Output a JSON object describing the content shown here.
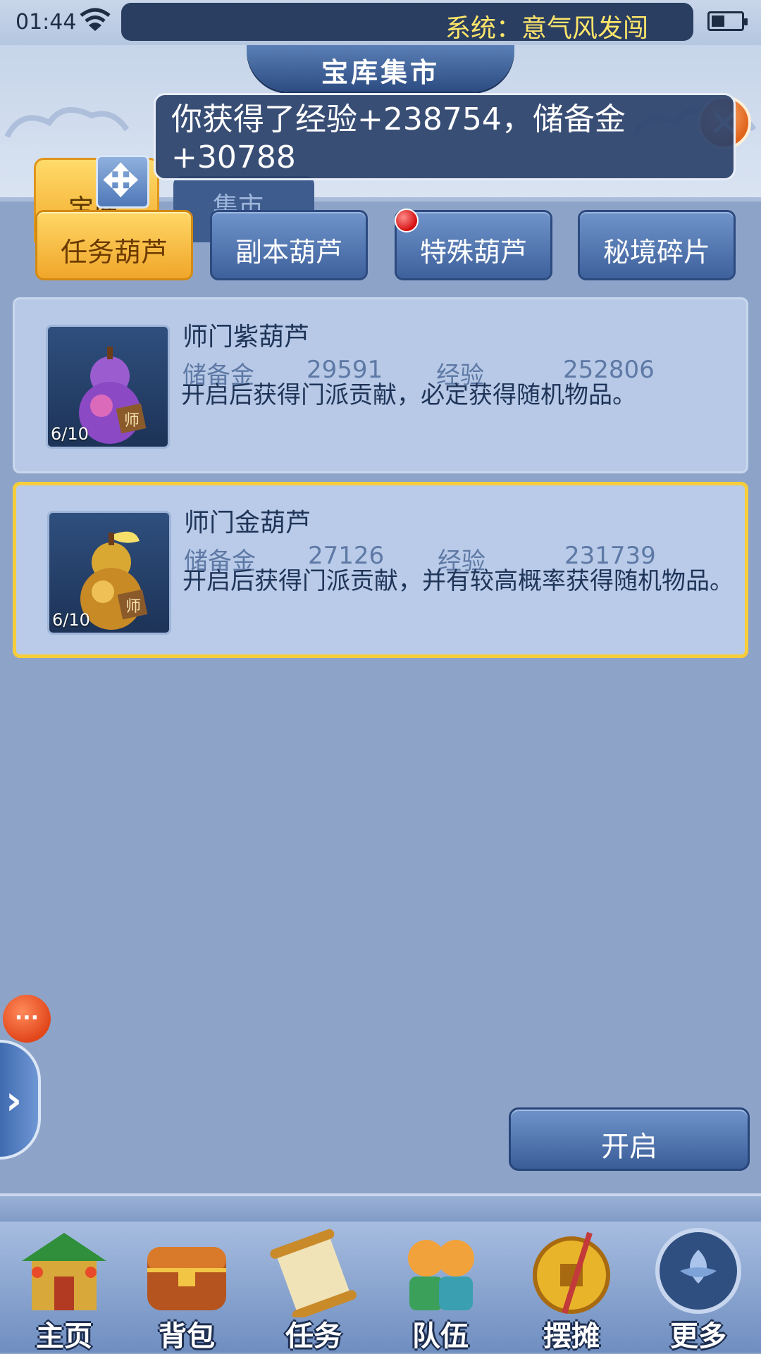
{
  "status_bar": {
    "time": "01:44",
    "marquee": "系统：意气风发闯",
    "icons": [
      "wifi-icon",
      "battery-icon"
    ]
  },
  "header": {
    "title": "宝库集市",
    "close_icon": "close-icon",
    "tabs": [
      {
        "label": "宝库",
        "active": true
      },
      {
        "label": "集市",
        "active": false
      }
    ]
  },
  "toast": {
    "message": "你获得了经验+238754，储备金+30788"
  },
  "categories": [
    {
      "label": "任务葫芦",
      "active": true
    },
    {
      "label": "副本葫芦",
      "active": false
    },
    {
      "label": "特殊葫芦",
      "active": false,
      "badge": "red-dot"
    },
    {
      "label": "秘境碎片",
      "active": false
    }
  ],
  "items": [
    {
      "name": "师门紫葫芦",
      "count": "6/10",
      "reserve_label": "储备金",
      "reserve_value": "29591",
      "exp_label": "经验",
      "exp_value": "252806",
      "description": "开启后获得门派贡献，必定获得随机物品。",
      "icon": "purple-gourd-icon",
      "selected": false
    },
    {
      "name": "师门金葫芦",
      "count": "6/10",
      "reserve_label": "储备金",
      "reserve_value": "27126",
      "exp_label": "经验",
      "exp_value": "231739",
      "description": "开启后获得门派贡献，并有较高概率获得随机物品。",
      "icon": "gold-gourd-icon",
      "selected": true
    }
  ],
  "side": {
    "bubble": "...",
    "pull_arrow": "›"
  },
  "open_button": "开启",
  "nav": [
    {
      "label": "主页",
      "icon": "home-icon"
    },
    {
      "label": "背包",
      "icon": "backpack-icon"
    },
    {
      "label": "任务",
      "icon": "quest-scroll-icon"
    },
    {
      "label": "队伍",
      "icon": "team-icon"
    },
    {
      "label": "摆摊",
      "icon": "stall-icon"
    },
    {
      "label": "更多",
      "icon": "more-icon"
    }
  ],
  "colors": {
    "accent_gold": "#f7cd3a",
    "panel_blue": "#8da4c8",
    "button_blue": "#3e619c",
    "notice_yellow": "#ffe66a"
  }
}
